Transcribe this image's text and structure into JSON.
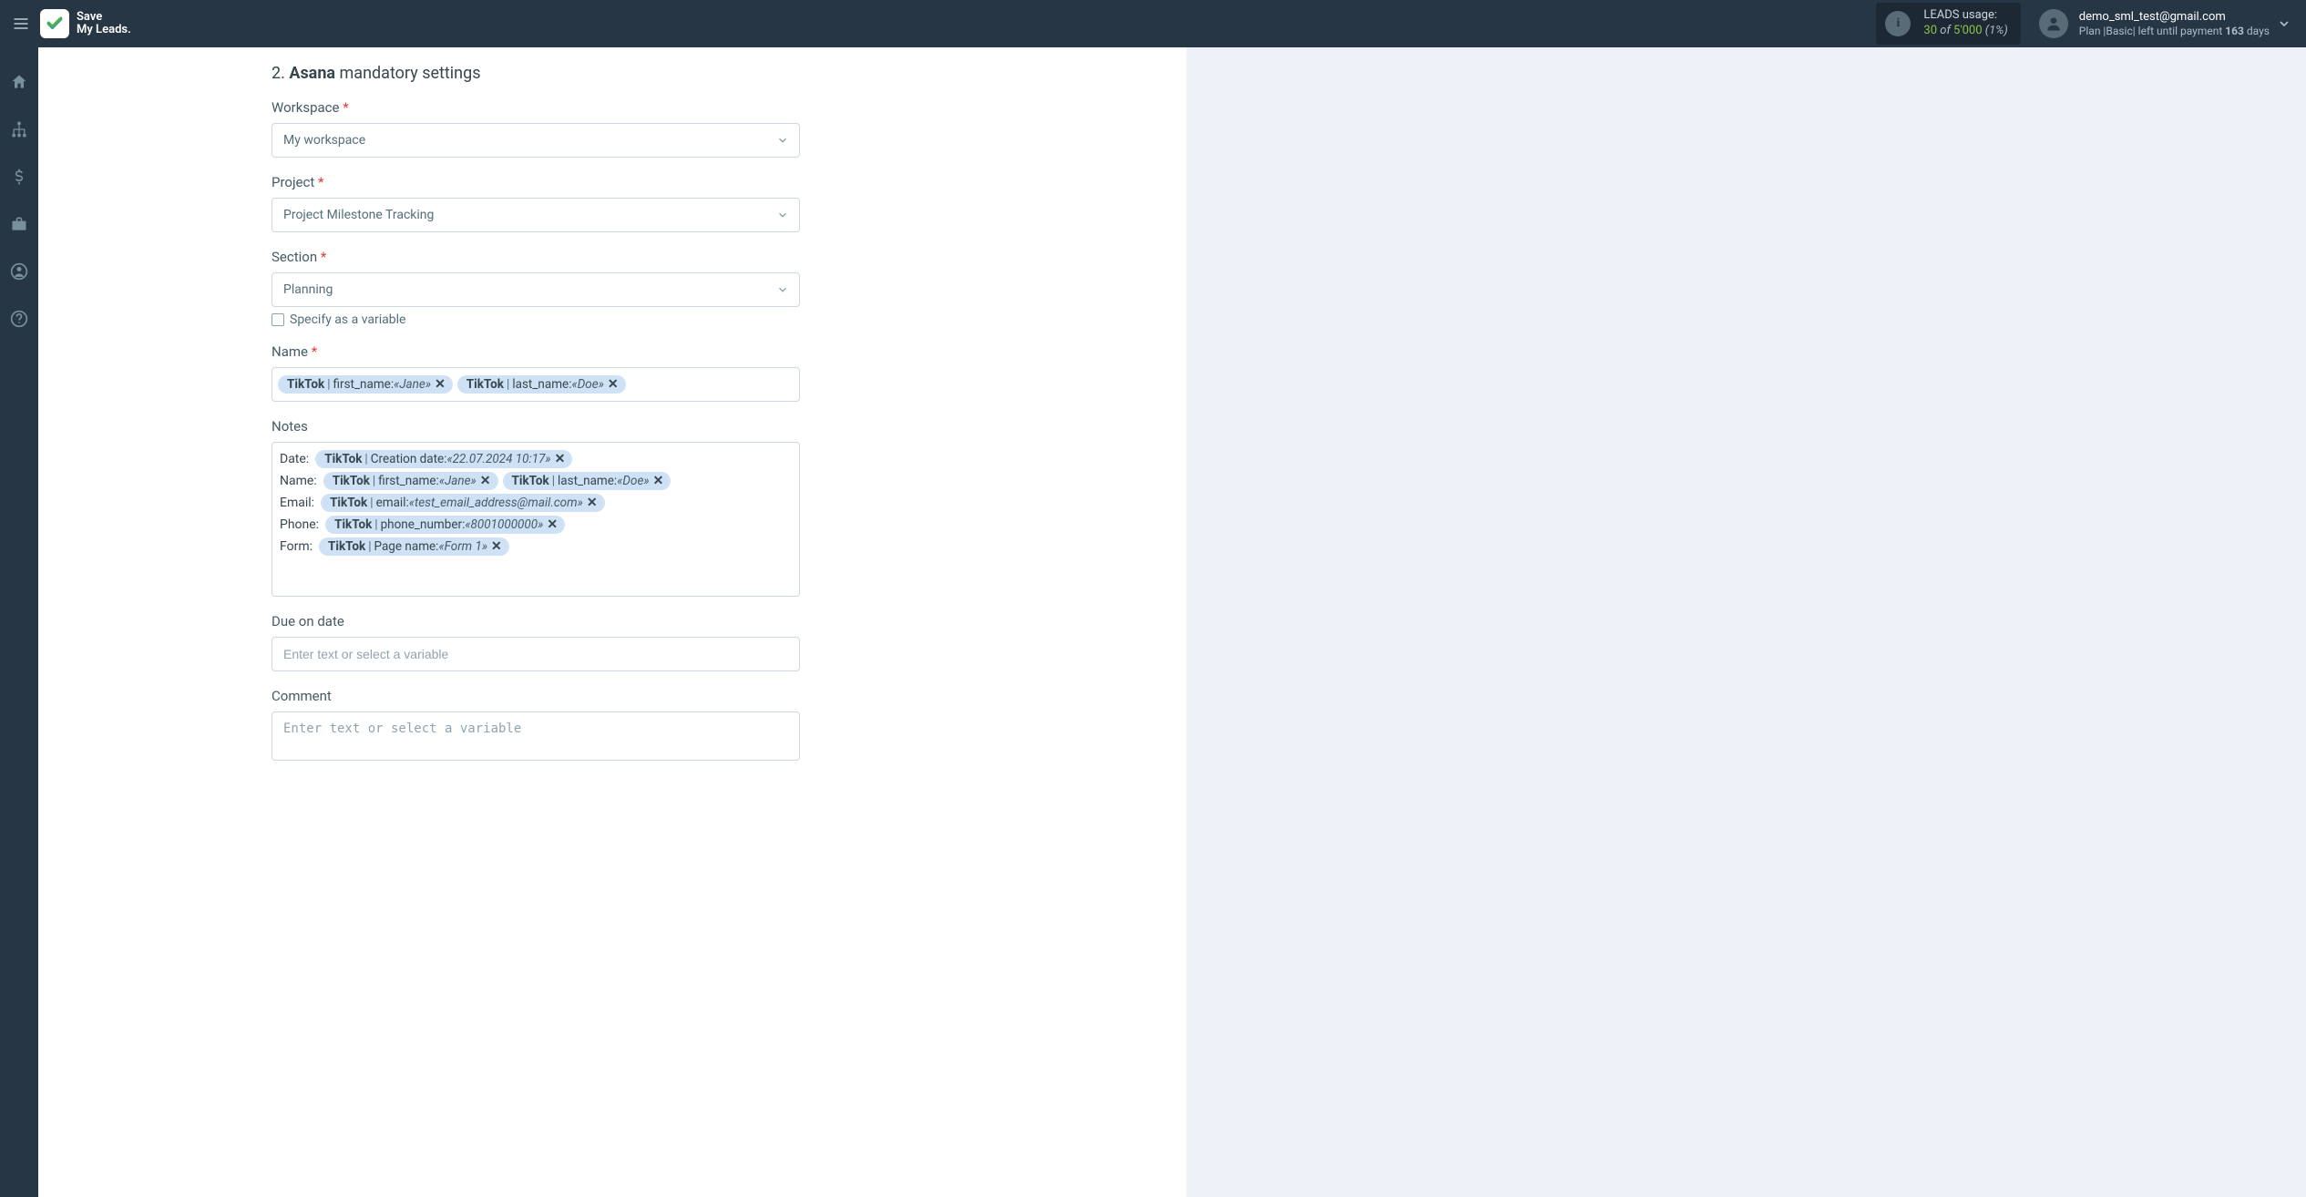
{
  "header": {
    "logo_line1": "Save",
    "logo_line2": "My Leads.",
    "usage_label": "LEADS usage:",
    "usage_current": "30",
    "usage_of": "of",
    "usage_limit": "5'000",
    "usage_pct": "(1%)",
    "account_email": "demo_sml_test@gmail.com",
    "plan_prefix": "Plan |",
    "plan_name": "Basic",
    "plan_mid": "| left until payment ",
    "plan_days_num": "163",
    "plan_days": " days"
  },
  "section": {
    "step": "2.",
    "product": "Asana",
    "title_rest": " mandatory settings"
  },
  "fields": {
    "workspace": {
      "label": "Workspace",
      "value": "My workspace"
    },
    "project": {
      "label": "Project",
      "value": "Project Milestone Tracking"
    },
    "section": {
      "label": "Section",
      "value": "Planning",
      "checkbox_label": "Specify as a variable"
    },
    "name": {
      "label": "Name",
      "tokens": [
        {
          "source": "TikTok",
          "field": "first_name",
          "value": "«Jane»"
        },
        {
          "source": "TikTok",
          "field": "last_name",
          "value": "«Doe»"
        }
      ]
    },
    "notes": {
      "label": "Notes",
      "rows": [
        {
          "label": "Date:",
          "tokens": [
            {
              "source": "TikTok",
              "field": "Creation date",
              "value": "«22.07.2024 10:17»"
            }
          ]
        },
        {
          "label": "Name:",
          "tokens": [
            {
              "source": "TikTok",
              "field": "first_name",
              "value": "«Jane»"
            },
            {
              "source": "TikTok",
              "field": "last_name",
              "value": "«Doe»"
            }
          ]
        },
        {
          "label": "Email:",
          "tokens": [
            {
              "source": "TikTok",
              "field": "email",
              "value": "«test_email_address@mail.com»"
            }
          ]
        },
        {
          "label": "Phone:",
          "tokens": [
            {
              "source": "TikTok",
              "field": "phone_number",
              "value": "«8001000000»"
            }
          ]
        },
        {
          "label": "Form:",
          "tokens": [
            {
              "source": "TikTok",
              "field": "Page name",
              "value": "«Form 1»"
            }
          ]
        }
      ]
    },
    "due": {
      "label": "Due on date",
      "placeholder": "Enter text or select a variable"
    },
    "comment": {
      "label": "Comment",
      "placeholder": "Enter text or select a variable"
    }
  }
}
